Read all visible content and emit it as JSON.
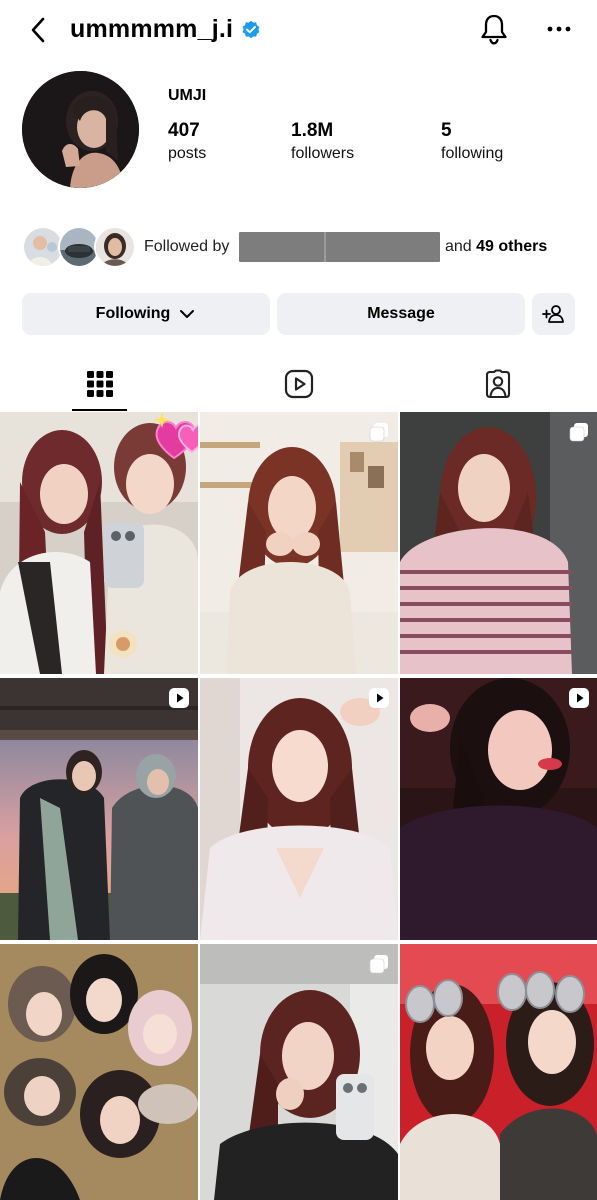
{
  "header": {
    "username": "ummmmm_j.i",
    "back_icon": "chevron-left-icon",
    "verified_icon": "verified-badge-icon",
    "notifications_icon": "bell-icon",
    "more_icon": "more-horizontal-icon",
    "verified_color": "#1d9bf0"
  },
  "profile": {
    "display_name": "UMJI",
    "stats": {
      "posts": {
        "value": "407",
        "label": "posts"
      },
      "followers": {
        "value": "1.8M",
        "label": "followers"
      },
      "following": {
        "value": "5",
        "label": "following"
      }
    }
  },
  "followed_by": {
    "prefix": "Followed by",
    "and": "and",
    "others": "49 others"
  },
  "actions": {
    "following_label": "Following",
    "message_label": "Message",
    "following_icon": "chevron-down-icon",
    "add_user_icon": "add-person-icon"
  },
  "tabs": [
    {
      "name": "posts-grid",
      "icon": "grid-icon",
      "active": true
    },
    {
      "name": "reels",
      "icon": "reels-icon",
      "active": false
    },
    {
      "name": "tagged",
      "icon": "tagged-person-icon",
      "active": false
    }
  ],
  "grid": [
    {
      "badge": "none",
      "sticker": "hearts"
    },
    {
      "badge": "carousel"
    },
    {
      "badge": "carousel"
    },
    {
      "badge": "reel"
    },
    {
      "badge": "reel"
    },
    {
      "badge": "reel"
    },
    {
      "badge": "none"
    },
    {
      "badge": "carousel"
    },
    {
      "badge": "none"
    }
  ],
  "colors": {
    "button_bg": "#eef0f3",
    "redaction": "#7d7d7d"
  }
}
